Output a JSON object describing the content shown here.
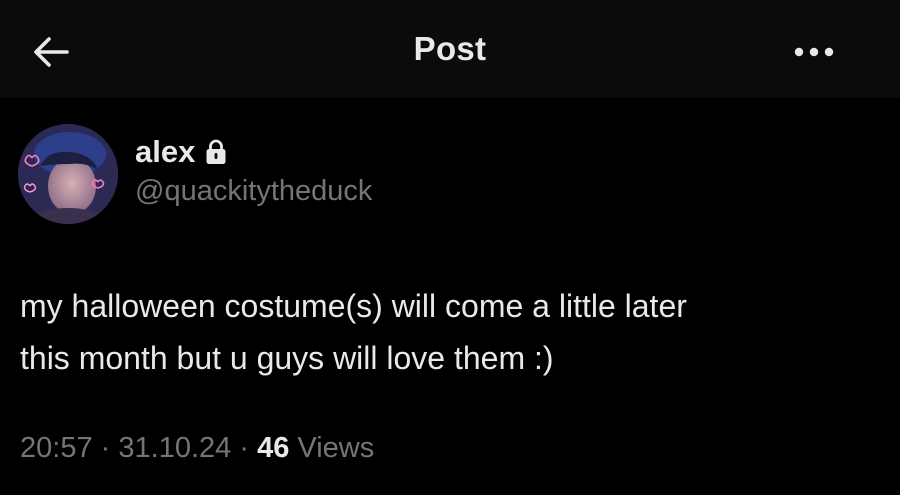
{
  "header": {
    "title": "Post",
    "back_icon": "arrow-left-icon",
    "more_icon": "more-horizontal-icon"
  },
  "author": {
    "name": "alex",
    "handle": "@quackitytheduck",
    "protected_icon": "lock-icon"
  },
  "post": {
    "lines": [
      "my halloween costume(s) will come a little later",
      "this month but u guys will love them :)"
    ],
    "time": "20:57",
    "separator": "·",
    "date": "31.10.24",
    "views_count": "46",
    "views_label": "Views"
  },
  "colors": {
    "background": "#000000",
    "header_background": "#0b0b0b",
    "primary_text": "#e7e9ea",
    "secondary_text": "#71767b"
  }
}
